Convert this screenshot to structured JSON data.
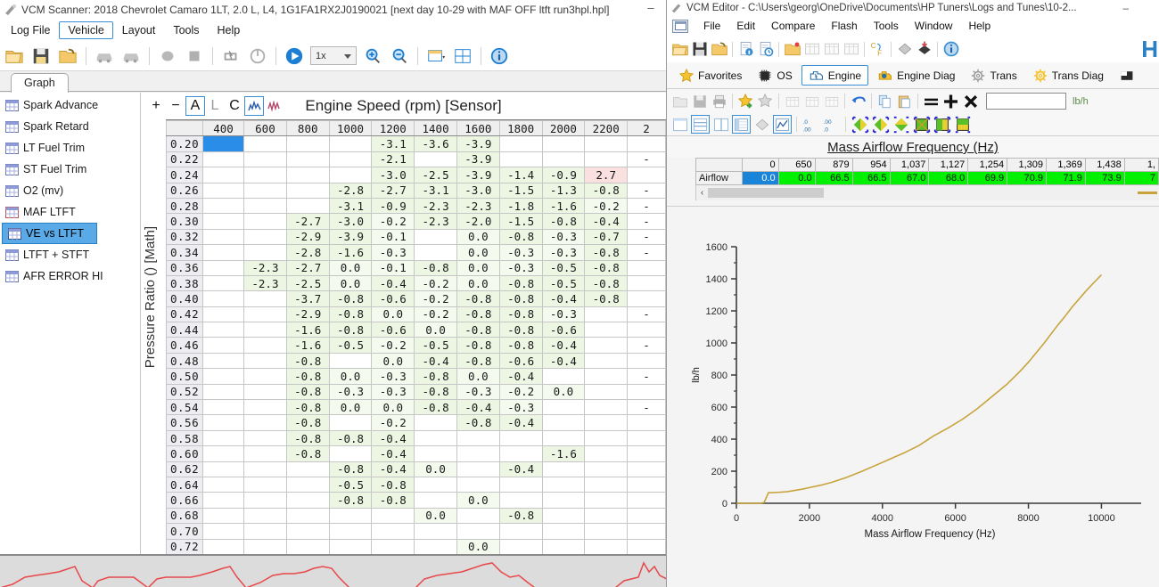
{
  "scanner": {
    "title": "VCM Scanner: 2018 Chevrolet Camaro 1LT, 2.0 L, L4, 1G1FA1RX2J0190021 [next day 10-29 with MAF OFF ltft run3hpl.hpl]",
    "minimize_label": "–",
    "menu": [
      {
        "label": "Log File",
        "active": false
      },
      {
        "label": "Vehicle",
        "active": true
      },
      {
        "label": "Layout",
        "active": false
      },
      {
        "label": "Tools",
        "active": false
      },
      {
        "label": "Help",
        "active": false
      }
    ],
    "toolbar": {
      "speed_value": "1x",
      "icons": [
        "open-folder-icon",
        "save-icon",
        "open-recent-icon",
        "vehicle-connect-icon",
        "vehicle-disconnect-icon",
        "record-icon",
        "stop-icon",
        "dtc-icon",
        "power-icon",
        "play-icon",
        "zoom-in-icon",
        "zoom-out-icon",
        "layout-icon",
        "split-layout-icon",
        "info-icon"
      ]
    },
    "tab": "Graph",
    "sidebar_items": [
      "Spark Advance",
      "Spark Retard",
      "LT Fuel Trim",
      "ST Fuel Trim",
      "O2 (mv)",
      "MAF LTFT",
      "VE vs LTFT",
      "LTFT + STFT",
      "AFR ERROR HI"
    ],
    "sidebar_selected": "VE vs LTFT",
    "graph_toolbar": [
      "+",
      "−",
      "A",
      "L",
      "C"
    ],
    "chart_title": "Engine Speed (rpm) [Sensor]",
    "vertical_axis_label": "Pressure Ratio () [Math]",
    "scroll_left_arrow": "‹"
  },
  "ve_table": {
    "title": "Engine Speed (rpm) [Sensor]",
    "row_axis": "Pressure Ratio () [Math]",
    "columns": [
      "400",
      "600",
      "800",
      "1000",
      "1200",
      "1400",
      "1600",
      "1800",
      "2000",
      "2200",
      "2"
    ],
    "rows": [
      {
        "label": "0.20",
        "values": [
          "",
          "",
          "",
          "",
          "-3.1",
          "-3.6",
          "-3.9",
          "",
          "",
          "",
          ""
        ]
      },
      {
        "label": "0.22",
        "values": [
          "",
          "",
          "",
          "",
          "-2.1",
          "",
          "-3.9",
          "",
          "",
          "",
          "-"
        ]
      },
      {
        "label": "0.24",
        "values": [
          "",
          "",
          "",
          "",
          "-3.0",
          "-2.5",
          "-3.9",
          "-1.4",
          "-0.9",
          "2.7",
          ""
        ]
      },
      {
        "label": "0.26",
        "values": [
          "",
          "",
          "",
          "-2.8",
          "-2.7",
          "-3.1",
          "-3.0",
          "-1.5",
          "-1.3",
          "-0.8",
          "-"
        ]
      },
      {
        "label": "0.28",
        "values": [
          "",
          "",
          "",
          "-3.1",
          "-0.9",
          "-2.3",
          "-2.3",
          "-1.8",
          "-1.6",
          "-0.2",
          "-"
        ]
      },
      {
        "label": "0.30",
        "values": [
          "",
          "",
          "-2.7",
          "-3.0",
          "-0.2",
          "-2.3",
          "-2.0",
          "-1.5",
          "-0.8",
          "-0.4",
          "-"
        ]
      },
      {
        "label": "0.32",
        "values": [
          "",
          "",
          "-2.9",
          "-3.9",
          "-0.1",
          "",
          "0.0",
          "-0.8",
          "-0.3",
          "-0.7",
          "-"
        ]
      },
      {
        "label": "0.34",
        "values": [
          "",
          "",
          "-2.8",
          "-1.6",
          "-0.3",
          "",
          "0.0",
          "-0.3",
          "-0.3",
          "-0.8",
          "-"
        ]
      },
      {
        "label": "0.36",
        "values": [
          "",
          "-2.3",
          "-2.7",
          "0.0",
          "-0.1",
          "-0.8",
          "0.0",
          "-0.3",
          "-0.5",
          "-0.8",
          ""
        ]
      },
      {
        "label": "0.38",
        "values": [
          "",
          "-2.3",
          "-2.5",
          "0.0",
          "-0.4",
          "-0.2",
          "0.0",
          "-0.8",
          "-0.5",
          "-0.8",
          ""
        ]
      },
      {
        "label": "0.40",
        "values": [
          "",
          "",
          "-3.7",
          "-0.8",
          "-0.6",
          "-0.2",
          "-0.8",
          "-0.8",
          "-0.4",
          "-0.8",
          ""
        ]
      },
      {
        "label": "0.42",
        "values": [
          "",
          "",
          "-2.9",
          "-0.8",
          "0.0",
          "-0.2",
          "-0.8",
          "-0.8",
          "-0.3",
          "",
          "-"
        ]
      },
      {
        "label": "0.44",
        "values": [
          "",
          "",
          "-1.6",
          "-0.8",
          "-0.6",
          "0.0",
          "-0.8",
          "-0.8",
          "-0.6",
          "",
          ""
        ]
      },
      {
        "label": "0.46",
        "values": [
          "",
          "",
          "-1.6",
          "-0.5",
          "-0.2",
          "-0.5",
          "-0.8",
          "-0.8",
          "-0.4",
          "",
          "-"
        ]
      },
      {
        "label": "0.48",
        "values": [
          "",
          "",
          "-0.8",
          "",
          "0.0",
          "-0.4",
          "-0.8",
          "-0.6",
          "-0.4",
          "",
          ""
        ]
      },
      {
        "label": "0.50",
        "values": [
          "",
          "",
          "-0.8",
          "0.0",
          "-0.3",
          "-0.8",
          "0.0",
          "-0.4",
          "",
          "",
          "-"
        ]
      },
      {
        "label": "0.52",
        "values": [
          "",
          "",
          "-0.8",
          "-0.3",
          "-0.3",
          "-0.8",
          "-0.3",
          "-0.2",
          "0.0",
          "",
          ""
        ]
      },
      {
        "label": "0.54",
        "values": [
          "",
          "",
          "-0.8",
          "0.0",
          "0.0",
          "-0.8",
          "-0.4",
          "-0.3",
          "",
          "",
          "-"
        ]
      },
      {
        "label": "0.56",
        "values": [
          "",
          "",
          "-0.8",
          "",
          "-0.2",
          "",
          "-0.8",
          "-0.4",
          "",
          "",
          ""
        ]
      },
      {
        "label": "0.58",
        "values": [
          "",
          "",
          "-0.8",
          "-0.8",
          "-0.4",
          "",
          "",
          "",
          "",
          "",
          ""
        ]
      },
      {
        "label": "0.60",
        "values": [
          "",
          "",
          "-0.8",
          "",
          "-0.4",
          "",
          "",
          "",
          "-1.6",
          "",
          ""
        ]
      },
      {
        "label": "0.62",
        "values": [
          "",
          "",
          "",
          "-0.8",
          "-0.4",
          "0.0",
          "",
          "-0.4",
          "",
          "",
          ""
        ]
      },
      {
        "label": "0.64",
        "values": [
          "",
          "",
          "",
          "-0.5",
          "-0.8",
          "",
          "",
          "",
          "",
          "",
          ""
        ]
      },
      {
        "label": "0.66",
        "values": [
          "",
          "",
          "",
          "-0.8",
          "-0.8",
          "",
          "0.0",
          "",
          "",
          "",
          ""
        ]
      },
      {
        "label": "0.68",
        "values": [
          "",
          "",
          "",
          "",
          "",
          "0.0",
          "",
          "-0.8",
          "",
          "",
          ""
        ]
      },
      {
        "label": "0.70",
        "values": [
          "",
          "",
          "",
          "",
          "",
          "",
          "",
          "",
          "",
          "",
          ""
        ]
      },
      {
        "label": "0.72",
        "values": [
          "",
          "",
          "",
          "",
          "",
          "",
          "0.0",
          "",
          "",
          "",
          ""
        ]
      }
    ],
    "selected_cell": {
      "row": "0.20",
      "col": "400"
    },
    "positive_cells": [
      {
        "row": "0.24",
        "col": "2200",
        "value": "2.7"
      }
    ]
  },
  "editor": {
    "title": "VCM Editor - C:\\Users\\georg\\OneDrive\\Documents\\HP Tuners\\Logs and Tunes\\10-2...",
    "minimize_label": "–",
    "menu": [
      "File",
      "Edit",
      "Compare",
      "Flash",
      "Tools",
      "Window",
      "Help"
    ],
    "brand": "H",
    "toolbar1_icons": [
      "open-icon",
      "save-icon",
      "save-as-icon",
      "read-info-icon",
      "read-history-icon",
      "open-tune-icon",
      "table-grid-1-icon",
      "table-grid-2-icon",
      "table-grid-3-icon",
      "unit-convert-icon",
      "flash-read-icon",
      "flash-write-icon",
      "info-icon"
    ],
    "tabs": [
      {
        "label": "Favorites",
        "icon": "star-icon",
        "active": false
      },
      {
        "label": "OS",
        "icon": "chip-icon",
        "active": false
      },
      {
        "label": "Engine",
        "icon": "engine-icon",
        "active": true
      },
      {
        "label": "Engine Diag",
        "icon": "engine-diag-icon",
        "active": false
      },
      {
        "label": "Trans",
        "icon": "gear-icon",
        "active": false
      },
      {
        "label": "Trans Diag",
        "icon": "gear-diag-icon",
        "active": false
      }
    ],
    "toolbar2_icons": [
      "open-icon",
      "save-icon",
      "print-icon",
      "add-favorite-icon",
      "remove-favorite-icon",
      "table-a-icon",
      "table-b-icon",
      "table-c-icon",
      "undo-icon",
      "copy-icon",
      "paste-icon",
      "equals-icon",
      "plus-icon",
      "multiply-icon"
    ],
    "unit_value": "",
    "unit_label": "lb/h",
    "toolbar3_icons": [
      "view-single-icon",
      "view-horizontal-split-icon",
      "view-vertical-split-icon",
      "view-table-icon",
      "view-3d-icon",
      "view-graph-icon",
      "decimal-decrease-icon",
      "decimal-increase-icon",
      "gradient-left-icon",
      "gradient-right-icon",
      "gradient-down-icon",
      "gradient-cross-icon",
      "gradient-box-icon",
      "gradient-bar-icon"
    ]
  },
  "maf_table": {
    "title": "Mass Airflow Frequency (Hz)",
    "row_label": "Airflow",
    "columns": [
      "0",
      "650",
      "879",
      "954",
      "1,037",
      "1,127",
      "1,254",
      "1,309",
      "1,369",
      "1,438",
      "1,"
    ],
    "values": [
      "0.0",
      "0.0",
      "66.5",
      "66.5",
      "67.0",
      "68.0",
      "69.9",
      "70.9",
      "71.9",
      "73.9",
      "7"
    ],
    "scroll_left_arrow": "‹"
  },
  "chart_data": {
    "type": "line",
    "title": "",
    "xlabel": "Mass Airflow Frequency (Hz)",
    "ylabel": "lb/h",
    "xlim": [
      0,
      10600
    ],
    "ylim": [
      0,
      1600
    ],
    "xticks": [
      0,
      2000,
      4000,
      6000,
      8000,
      10000
    ],
    "yticks": [
      0,
      200,
      400,
      600,
      800,
      1000,
      1200,
      1400,
      1600
    ],
    "grid": false,
    "legend": "none",
    "line_color": "#c8a33c",
    "series": [
      {
        "name": "Airflow",
        "x": [
          0,
          300,
          650,
          760,
          879,
          954,
          1037,
          1127,
          1254,
          1309,
          1369,
          1438,
          1600,
          1800,
          2000,
          2300,
          2600,
          3000,
          3400,
          3800,
          4200,
          4600,
          5000,
          5200,
          5400,
          5800,
          6200,
          6600,
          7000,
          7400,
          7800,
          8000,
          8400,
          8800,
          9000,
          9200,
          9600,
          10000
        ],
        "y": [
          0,
          0,
          0,
          5,
          66.5,
          66.5,
          67.0,
          68.0,
          69.9,
          70.9,
          71.9,
          73.9,
          80,
          88,
          98,
          112,
          130,
          160,
          196,
          235,
          275,
          315,
          360,
          390,
          420,
          470,
          525,
          590,
          665,
          740,
          830,
          880,
          990,
          1110,
          1165,
          1225,
          1330,
          1425
        ]
      }
    ]
  }
}
